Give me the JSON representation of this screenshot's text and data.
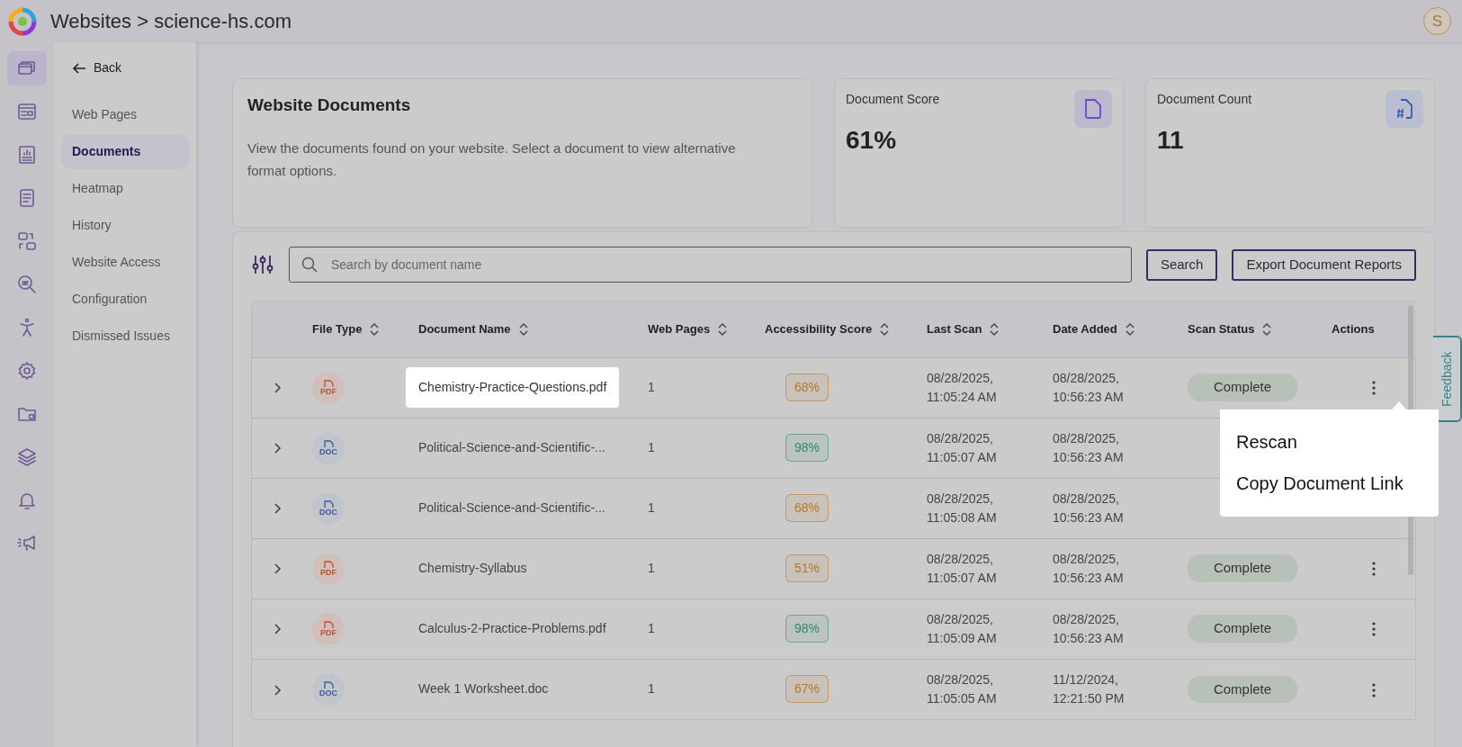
{
  "header": {
    "title": "Websites > science-hs.com",
    "avatar": "S"
  },
  "rail": [
    {
      "selected": true
    },
    {
      "selected": false
    },
    {
      "selected": false
    },
    {
      "selected": false
    },
    {
      "selected": false
    },
    {
      "selected": false
    },
    {
      "selected": false
    },
    {
      "selected": false
    },
    {
      "selected": false
    },
    {
      "selected": false
    },
    {
      "selected": false
    },
    {
      "selected": false
    }
  ],
  "sidebar": {
    "back": "Back",
    "items": [
      {
        "label": "Web Pages",
        "selected": false
      },
      {
        "label": "Documents",
        "selected": true
      },
      {
        "label": "Heatmap",
        "selected": false
      },
      {
        "label": "History",
        "selected": false
      },
      {
        "label": "Website Access",
        "selected": false
      },
      {
        "label": "Configuration",
        "selected": false
      },
      {
        "label": "Dismissed Issues",
        "selected": false
      }
    ]
  },
  "intro": {
    "title": "Website Documents",
    "text": "View the documents found on your website. Select a document to view alternative format options."
  },
  "stats": [
    {
      "label": "Document Score",
      "value": "61%"
    },
    {
      "label": "Document Count",
      "value": "11"
    }
  ],
  "search": {
    "placeholder": "Search by document name",
    "button": "Search",
    "export": "Export Document Reports"
  },
  "table": {
    "columns": [
      {
        "label": "File Type",
        "sortable": true
      },
      {
        "label": "Document Name",
        "sortable": true
      },
      {
        "label": "Web Pages",
        "sortable": true
      },
      {
        "label": "Accessibility Score",
        "sortable": true
      },
      {
        "label": "Last Scan",
        "sortable": true
      },
      {
        "label": "Date Added",
        "sortable": true
      },
      {
        "label": "Scan Status",
        "sortable": true
      },
      {
        "label": "Actions",
        "sortable": false
      }
    ],
    "rows": [
      {
        "file_type": "PDF",
        "name": "Chemistry-Practice-Questions.pdf",
        "highlighted": true,
        "web_pages": "1",
        "score": {
          "text": "68%",
          "color": "#b5772a"
        },
        "last_scan": "08/28/2025,\n11:05:24 AM",
        "date_added": "08/28/2025,\n10:56:23 AM",
        "status": "Complete",
        "menu_open": true
      },
      {
        "file_type": "DOC",
        "name": "Political-Science-and-Scientific-...",
        "highlighted": false,
        "web_pages": "1",
        "score": {
          "text": "98%",
          "color": "#2e8a66"
        },
        "last_scan": "08/28/2025,\n11:05:07 AM",
        "date_added": "08/28/2025,\n10:56:23 AM"
      },
      {
        "file_type": "DOC",
        "name": "Political-Science-and-Scientific-...",
        "highlighted": false,
        "web_pages": "1",
        "score": {
          "text": "68%",
          "color": "#b5772a"
        },
        "last_scan": "08/28/2025,\n11:05:08 AM",
        "date_added": "08/28/2025,\n10:56:23 AM"
      },
      {
        "file_type": "PDF",
        "name": "Chemistry-Syllabus",
        "highlighted": false,
        "web_pages": "1",
        "score": {
          "text": "51%",
          "color": "#b5772a"
        },
        "last_scan": "08/28/2025,\n11:05:07 AM",
        "date_added": "08/28/2025,\n10:56:23 AM",
        "status": "Complete",
        "menu_open": false
      },
      {
        "file_type": "PDF",
        "name": "Calculus-2-Practice-Problems.pdf",
        "highlighted": false,
        "web_pages": "1",
        "score": {
          "text": "98%",
          "color": "#2e8a66"
        },
        "last_scan": "08/28/2025,\n11:05:09 AM",
        "date_added": "08/28/2025,\n10:56:23 AM",
        "status": "Complete",
        "menu_open": false
      },
      {
        "file_type": "DOC",
        "name": "Week 1 Worksheet.doc",
        "highlighted": false,
        "web_pages": "1",
        "score": {
          "text": "67%",
          "color": "#b5772a"
        },
        "last_scan": "08/28/2025,\n11:05:05 AM",
        "date_added": "11/12/2024,\n12:21:50 PM",
        "status": "Complete",
        "menu_open": false
      }
    ]
  },
  "menu": [
    "Rescan",
    "Copy Document Link"
  ],
  "feedback": "Feedback"
}
